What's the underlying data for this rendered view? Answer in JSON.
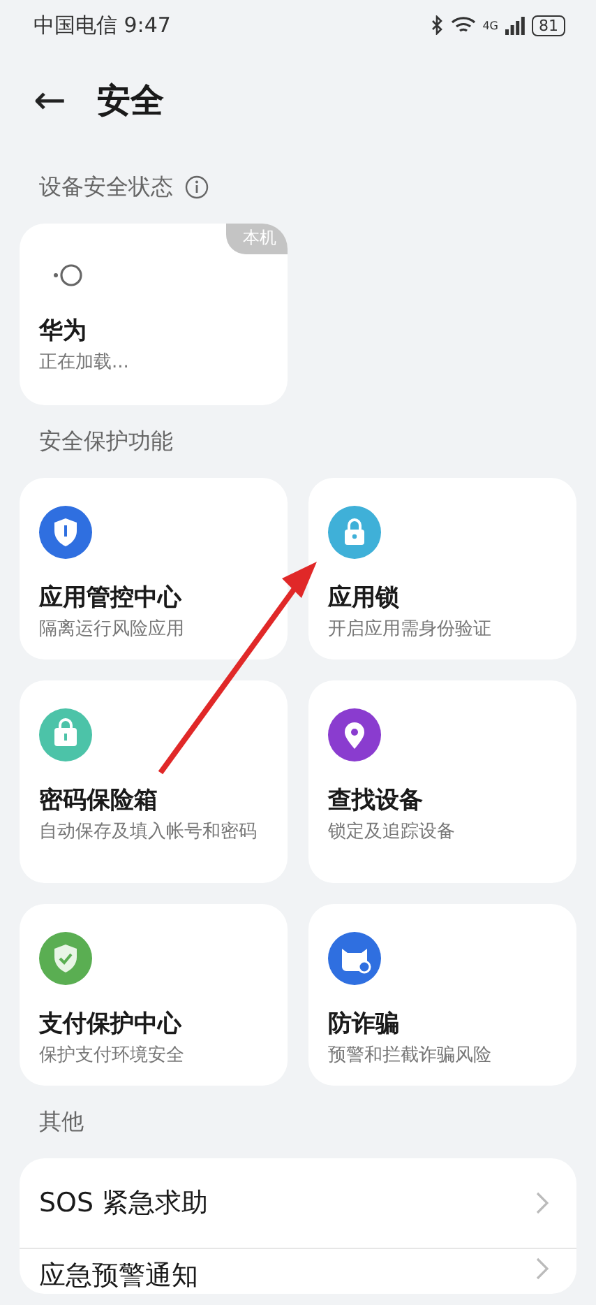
{
  "status_bar": {
    "carrier_time": "中国电信 9:47",
    "network": "4G",
    "battery": "81"
  },
  "header": {
    "back": "←",
    "title": "安全"
  },
  "device_section": {
    "label": "设备安全状态",
    "device": {
      "tag": "本机",
      "name": "华为",
      "status": "正在加载..."
    }
  },
  "features_section": {
    "label": "安全保护功能",
    "items": [
      {
        "kind": "shield",
        "color": "#2f6fe0",
        "title": "应用管控中心",
        "subtitle": "隔离运行风险应用"
      },
      {
        "kind": "lock",
        "color": "#3fb0d8",
        "title": "应用锁",
        "subtitle": "开启应用需身份验证"
      },
      {
        "kind": "safe",
        "color": "#4cc3a8",
        "title": "密码保险箱",
        "subtitle": "自动保存及填入帐号和密码"
      },
      {
        "kind": "pin",
        "color": "#8a3ccf",
        "title": "查找设备",
        "subtitle": "锁定及追踪设备"
      },
      {
        "kind": "check",
        "color": "#5aae52",
        "title": "支付保护中心",
        "subtitle": "保护支付环境安全"
      },
      {
        "kind": "cat",
        "color": "#2f6fe0",
        "title": "防诈骗",
        "subtitle": "预警和拦截诈骗风险"
      }
    ]
  },
  "other_section": {
    "label": "其他",
    "items": [
      {
        "title": "SOS 紧急求助"
      },
      {
        "title": "应急预警通知"
      }
    ]
  }
}
